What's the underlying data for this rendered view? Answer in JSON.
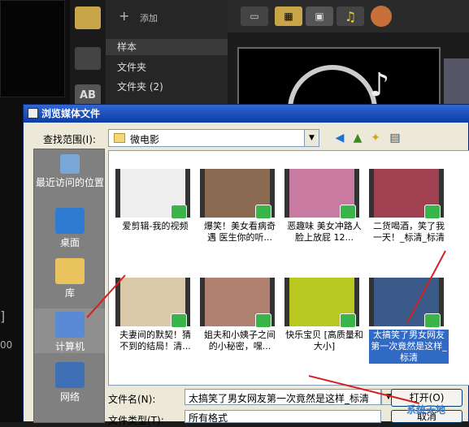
{
  "editor": {
    "add_label": "添加",
    "library_items": [
      "样本",
      "文件夹",
      "文件夹 (2)"
    ],
    "timecode": "00"
  },
  "dialog": {
    "title": "浏览媒体文件",
    "lookin_label": "查找范围(I):",
    "lookin_value": "微电影",
    "places": [
      "最近访问的位置",
      "桌面",
      "库",
      "计算机",
      "网络"
    ],
    "files": [
      {
        "name": "爱剪辑-我的视频"
      },
      {
        "name": "爆笑！美女看病奇遇 医生你的听..."
      },
      {
        "name": "恶趣味 美女冲路人脸上放屁 12..."
      },
      {
        "name": "二货喝酒，笑了我一天！_标清_标清"
      },
      {
        "name": "夫妻间的默契！猜不到的结局！清..."
      },
      {
        "name": "姐夫和小姨子之间的小秘密，嘿..."
      },
      {
        "name": "快乐宝贝 [高质量和大小]"
      },
      {
        "name": "太搞笑了男女网友第一次竟然是这样_标清",
        "selected": true
      }
    ],
    "filename_label": "文件名(N):",
    "filename_value": "太搞笑了男女网友第一次竟然是这样_标清",
    "filetype_label": "文件类型(T):",
    "filetype_value": "所有格式",
    "open_label": "打开(O)",
    "cancel_label": "取消"
  },
  "watermark": "系统天地"
}
